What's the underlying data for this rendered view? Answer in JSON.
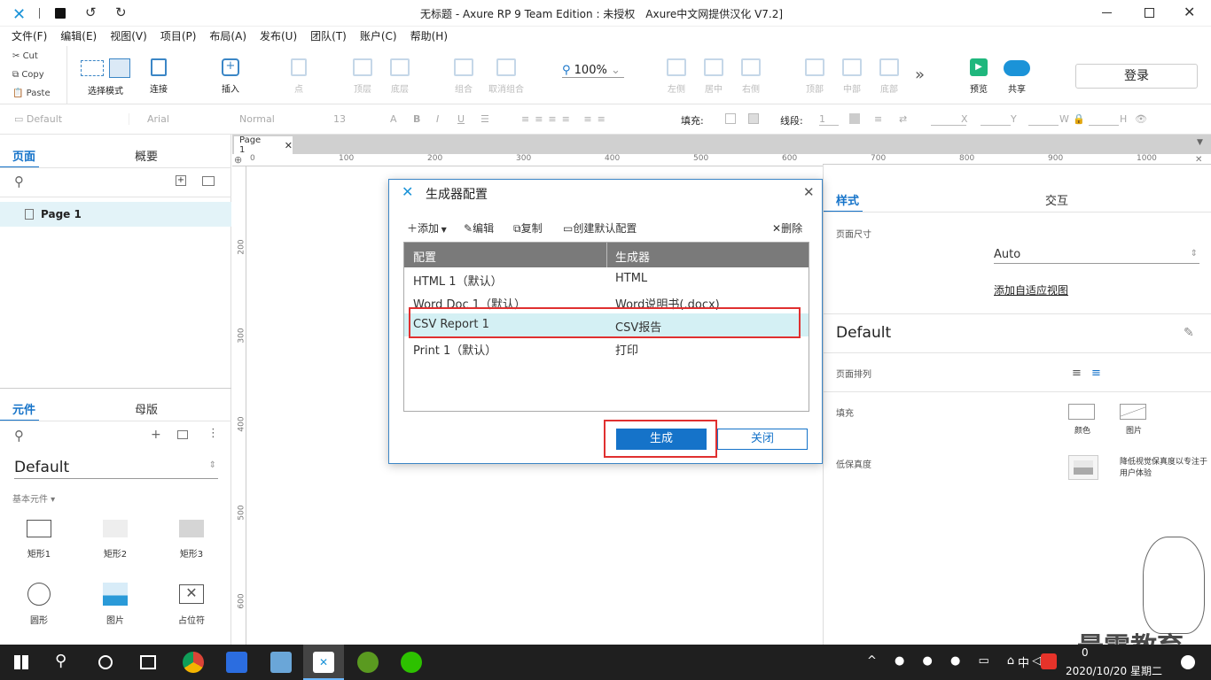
{
  "window": {
    "title": "无标题 - Axure RP 9 Team Edition : 未授权　Axure中文网提供汉化 V7.2]",
    "logo_icon": "axure-x-icon"
  },
  "menu": [
    "文件(F)",
    "编辑(E)",
    "视图(V)",
    "项目(P)",
    "布局(A)",
    "发布(U)",
    "团队(T)",
    "账户(C)",
    "帮助(H)"
  ],
  "clipboard": {
    "cut": "Cut",
    "copy": "Copy",
    "paste": "Paste"
  },
  "toolbar": {
    "select_mode": "选择模式",
    "connect": "连接",
    "insert": "插入",
    "point": "点",
    "top": "顶层",
    "bottom": "底层",
    "group": "组合",
    "ungroup": "取消组合",
    "zoom": "100%",
    "left": "左侧",
    "center": "居中",
    "right": "右侧",
    "valign_top": "顶部",
    "valign_middle": "中部",
    "valign_bottom": "底部",
    "more": "»",
    "preview": "预览",
    "share": "共享",
    "login": "登录"
  },
  "formatbar": {
    "style": "Default",
    "font": "Arial",
    "weight": "Normal",
    "size": "13",
    "fill_label": "填充:",
    "line_label": "线段:",
    "line_value": "1",
    "x_label": "X",
    "y_label": "Y",
    "w_label": "W",
    "h_label": "H"
  },
  "left_panel": {
    "tab_pages": "页面",
    "tab_outline": "概要",
    "page_item": "Page 1",
    "tab_widgets": "元件",
    "tab_masters": "母版",
    "library": "Default",
    "basic_widgets": "基本元件 ▾",
    "widgets": [
      "矩形1",
      "矩形2",
      "矩形3",
      "圆形",
      "图片",
      "占位符"
    ]
  },
  "canvas": {
    "tab": "Page 1",
    "ruler_h": [
      "0",
      "100",
      "200",
      "300",
      "400",
      "500",
      "600",
      "700",
      "800",
      "900",
      "1000"
    ],
    "ruler_v": [
      "200",
      "300",
      "400",
      "500",
      "600"
    ]
  },
  "right_panel": {
    "tab_style": "样式",
    "tab_interact": "交互",
    "page_size_label": "页面尺寸",
    "page_size_value": "Auto",
    "adaptive_link": "添加自适应视图",
    "style_name": "Default",
    "page_align_label": "页面排列",
    "fill_label": "填充",
    "fill_color": "颜色",
    "fill_image": "图片",
    "low_fidelity_label": "低保真度",
    "low_fidelity_text": "降低视觉保真度以专注于用户体验"
  },
  "dialog": {
    "title": "生成器配置",
    "toolbar": {
      "add": "添加",
      "edit": "编辑",
      "copy": "复制",
      "create_default": "创建默认配置",
      "delete": "删除"
    },
    "columns": [
      "配置",
      "生成器"
    ],
    "rows": [
      {
        "config": "HTML 1（默认）",
        "generator": "HTML"
      },
      {
        "config": "Word Doc 1（默认）",
        "generator": "Word说明书(.docx)"
      },
      {
        "config": "CSV Report 1",
        "generator": "CSV报告"
      },
      {
        "config": "Print 1（默认）",
        "generator": "打印"
      }
    ],
    "generate_button": "生成",
    "close_button": "关闭"
  },
  "watermark": "最需教育",
  "taskbar": {
    "time": "0",
    "date": "2020/10/20 星期二",
    "ime": "中"
  },
  "colors": {
    "accent": "#1573c9",
    "highlight_red": "#e03030",
    "selected_row": "#d4f0f4"
  }
}
